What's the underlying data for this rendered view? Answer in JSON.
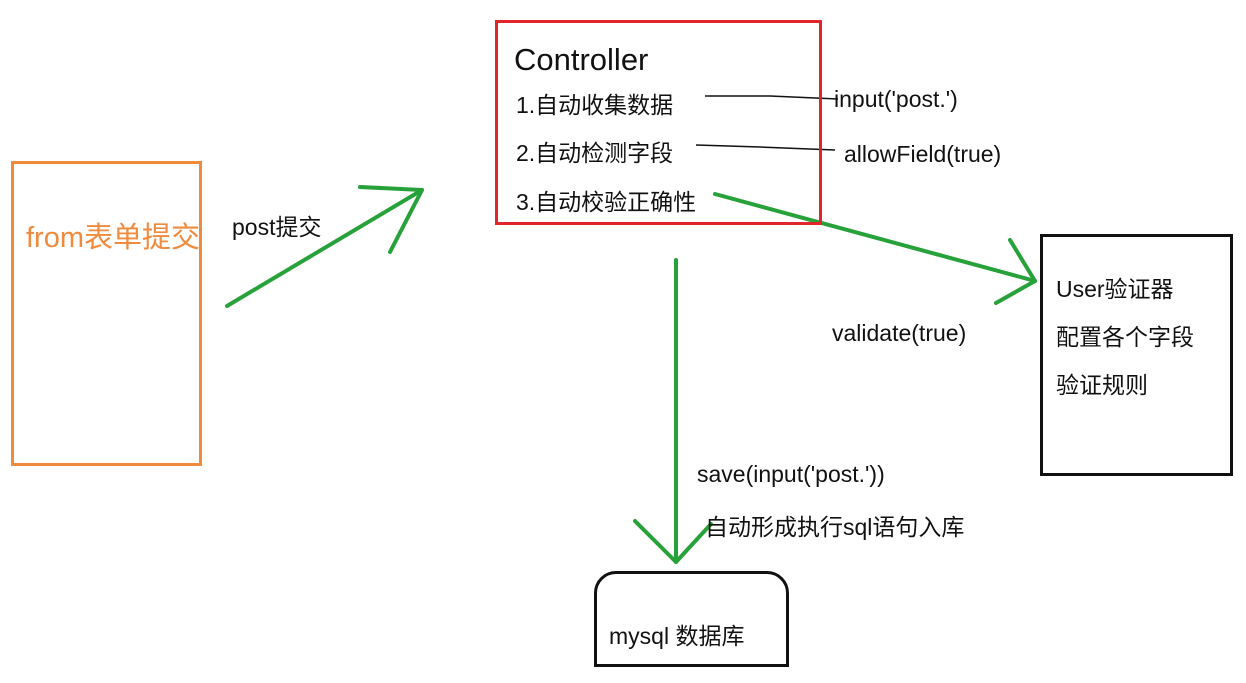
{
  "colors": {
    "form": "#f08a3c",
    "controller": "#e0262b",
    "arrow": "#27a23a",
    "line": "#111111"
  },
  "form_box": {
    "label": "from表单提交"
  },
  "controller": {
    "title": "Controller",
    "steps": [
      "1.自动收集数据",
      "2.自动检测字段",
      "3.自动校验正确性"
    ]
  },
  "annotations": {
    "input_post": "input('post.')",
    "allow_field": "allowField(true)",
    "post_submit": "post提交",
    "validate": "validate(true)",
    "save": "save(input('post.'))",
    "auto_sql": "自动形成执行sql语句入库"
  },
  "validator": {
    "lines": [
      "User验证器",
      "配置各个字段",
      "验证规则"
    ]
  },
  "database": {
    "label": "mysql 数据库"
  },
  "icons": [
    "arrow-icon"
  ]
}
